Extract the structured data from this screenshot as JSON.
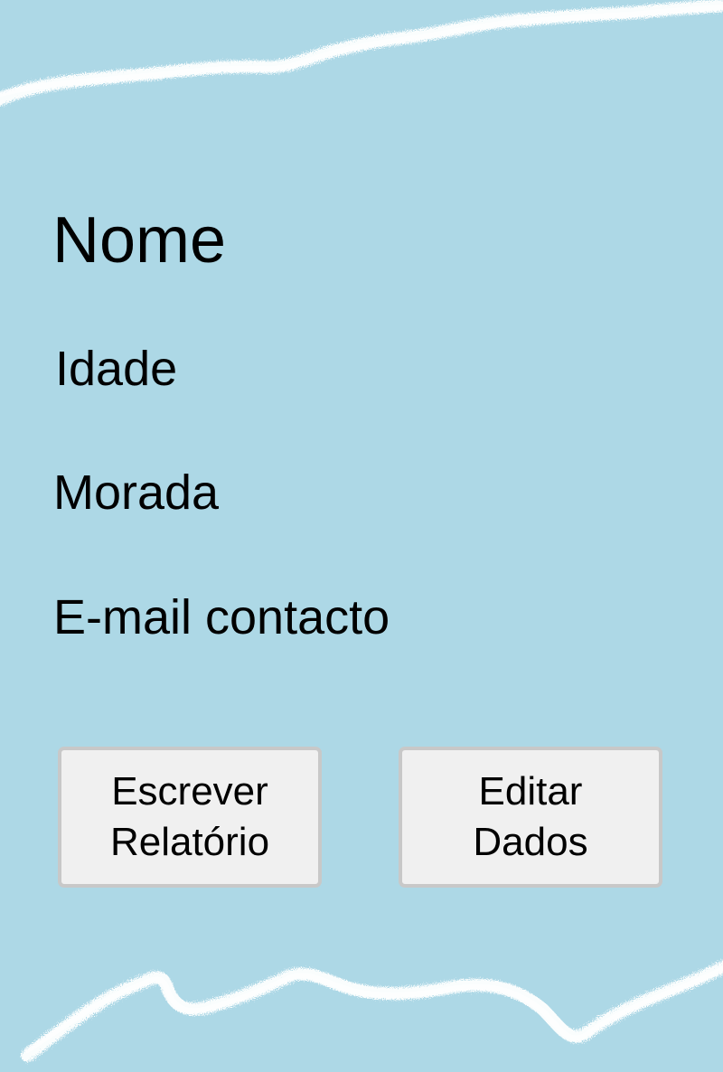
{
  "profile": {
    "name_label": "Nome",
    "age_label": "Idade",
    "address_label": "Morada",
    "email_label": "E-mail contacto"
  },
  "actions": {
    "write_report": {
      "line1": "Escrever",
      "line2": "Relatório"
    },
    "edit_data": {
      "line1": "Editar",
      "line2": "Dados"
    }
  },
  "colors": {
    "background": "#add8e6",
    "button_fill": "#f0f0f0",
    "button_border": "#c8c8c8",
    "wave": "#ffffff"
  }
}
